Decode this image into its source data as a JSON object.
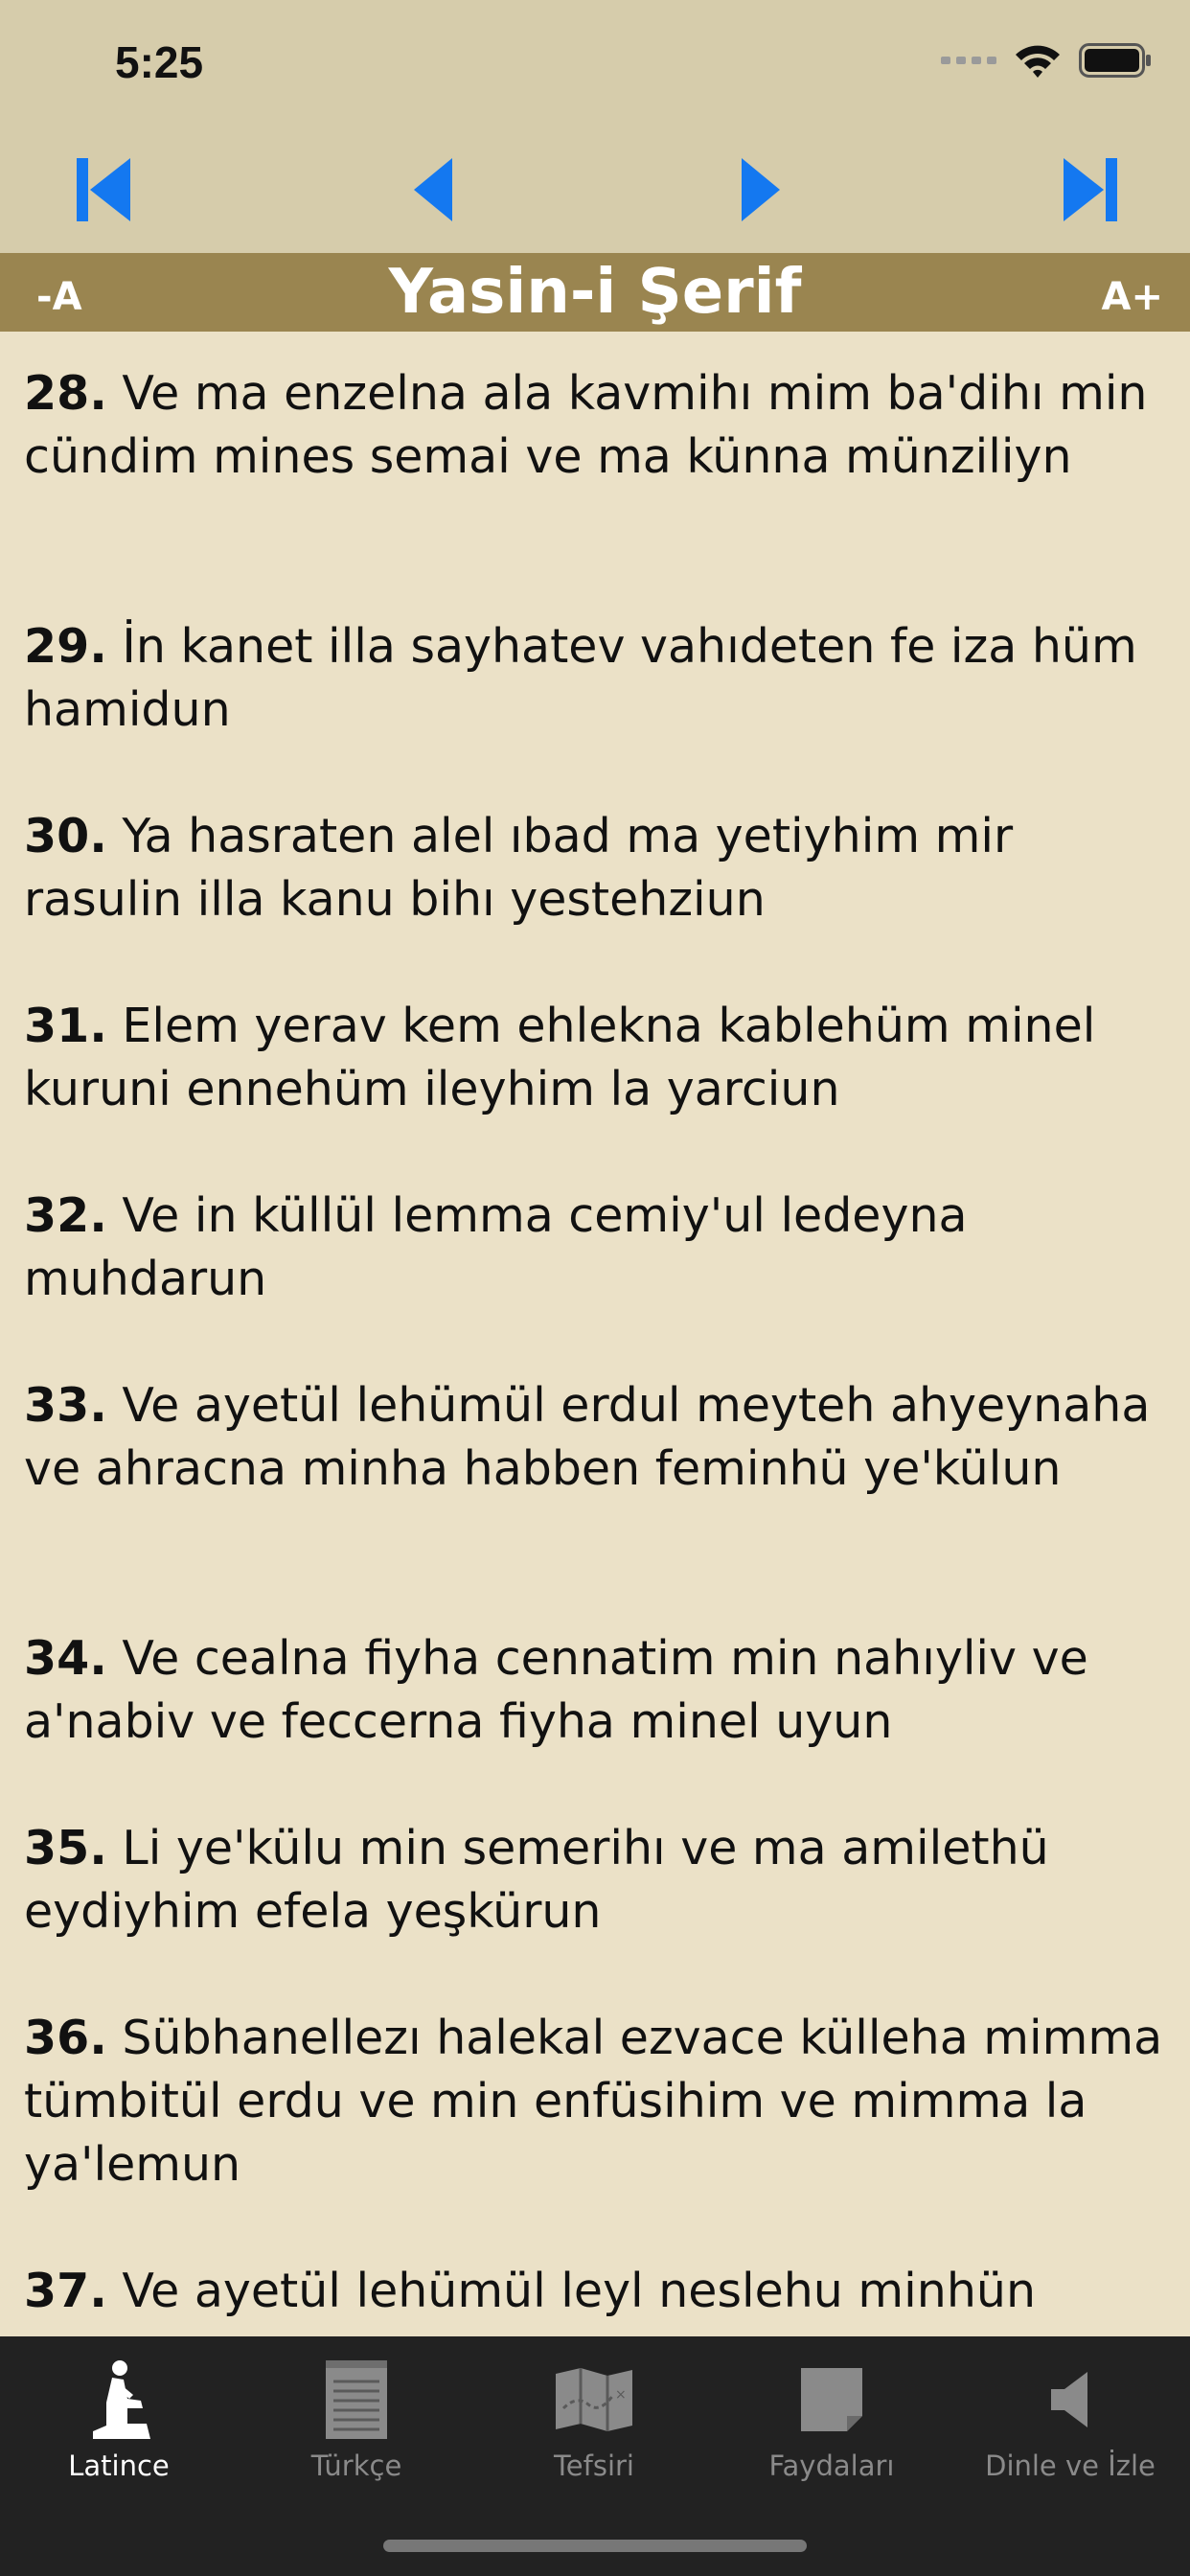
{
  "status": {
    "time": "5:25"
  },
  "header": {
    "title": "Yasin-i Şerif",
    "font_decrease": "-A",
    "font_increase": "A+"
  },
  "nav": {
    "icons": [
      "skip-to-first-icon",
      "previous-icon",
      "next-icon",
      "skip-to-last-icon"
    ],
    "accent_color": "#1478f0"
  },
  "verses": [
    {
      "num": "28.",
      "text": " Ve ma enzelna ala kavmihı mim ba'dihı min cündim mines semai ve ma künna münziliyn"
    },
    {
      "num": "29.",
      "text": " İn kanet illa sayhatev vahıdeten fe iza hüm hamidun"
    },
    {
      "num": "30.",
      "text": " Ya hasraten alel ıbad ma yetiyhim mir rasulin illa kanu bihı yestehziun"
    },
    {
      "num": "31.",
      "text": " Elem yerav kem ehlekna kablehüm minel kuruni ennehüm ileyhim la yarciun"
    },
    {
      "num": "32.",
      "text": " Ve in küllül lemma cemiy'ul ledeyna muhdarun"
    },
    {
      "num": "33.",
      "text": " Ve ayetül lehümül erdul meyteh ahyeynaha ve ahracna minha habben feminhü ye'külun"
    },
    {
      "num": "34.",
      "text": " Ve cealna fiyha cennatim min nahıyliv ve a'nabiv ve feccerna fiyha minel uyun"
    },
    {
      "num": "35.",
      "text": " Li ye'külu min semerihı ve ma amilethü eydiyhim efela yeşkürun"
    },
    {
      "num": "36.",
      "text": " Sübhanellezı halekal ezvace külleha mimma tümbitül erdu ve min enfüsihim ve mimma la ya'lemun"
    },
    {
      "num": "37.",
      "text": " Ve ayetül lehümül leyl neslehu minhün"
    }
  ],
  "tabs": [
    {
      "label": "Latince",
      "active": true
    },
    {
      "label": "Türkçe",
      "active": false
    },
    {
      "label": "Tefsiri",
      "active": false
    },
    {
      "label": "Faydaları",
      "active": false
    },
    {
      "label": "Dinle ve İzle",
      "active": false
    }
  ],
  "colors": {
    "background": "#ebe1c7",
    "header": "#d6ccab",
    "title_bar": "#9a8550",
    "tab_bar": "#222222"
  }
}
